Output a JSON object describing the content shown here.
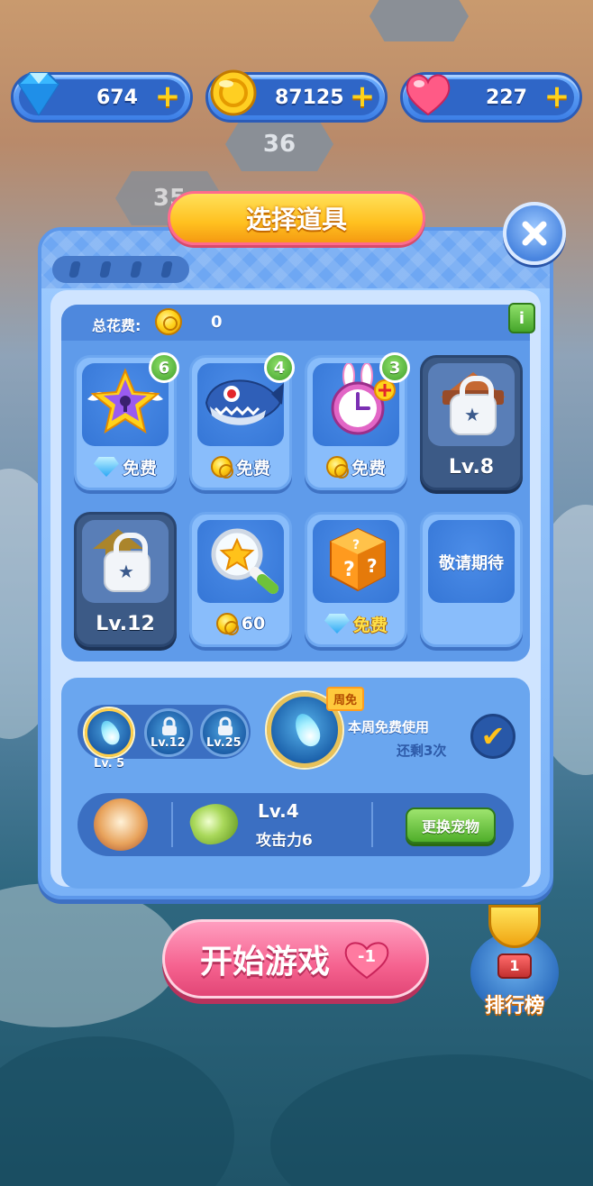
{
  "resources": {
    "gems": "674",
    "coins": "87125",
    "hearts": "227"
  },
  "background": {
    "tiles": [
      "36",
      "35"
    ]
  },
  "dialog": {
    "title": "选择道具",
    "total_cost_label": "总花费:",
    "total_cost_value": "0",
    "info_label": "i",
    "items": [
      {
        "name": "star-keyhole",
        "price": "免费",
        "currency": "diamond",
        "count": "6",
        "locked": false
      },
      {
        "name": "piranha",
        "price": "免费",
        "currency": "coin",
        "count": "4",
        "locked": false
      },
      {
        "name": "alarm-clock-plus",
        "price": "免费",
        "currency": "coin",
        "count": "3",
        "locked": false
      },
      {
        "name": "super-locked",
        "level": "Lv.8",
        "locked": true
      },
      {
        "name": "arrow-locked",
        "level": "Lv.12",
        "locked": true
      },
      {
        "name": "magnifier-star",
        "price": "60",
        "currency": "coin",
        "locked": false
      },
      {
        "name": "mystery-dice",
        "price": "免费",
        "currency": "diamond",
        "locked": false
      },
      {
        "name": "coming-soon",
        "label": "敬请期待",
        "locked": false
      }
    ],
    "skills": {
      "levels": [
        "Lv. 5",
        "Lv.12",
        "Lv.25"
      ],
      "week_tag": "周免",
      "free_text": "本周免费使用",
      "remaining_text": "还剩3次"
    },
    "pet": {
      "level": "Lv.4",
      "attack": "攻击力6",
      "swap_label": "更换宠物"
    }
  },
  "start": {
    "label": "开始游戏",
    "heart_cost": "-1"
  },
  "leaderboard": {
    "label": "排行榜",
    "rank": "1"
  },
  "colors": {
    "accent": "#ffc01f",
    "panel": "#7ab2f7",
    "start": "#f5628f",
    "green": "#4fae2a"
  }
}
